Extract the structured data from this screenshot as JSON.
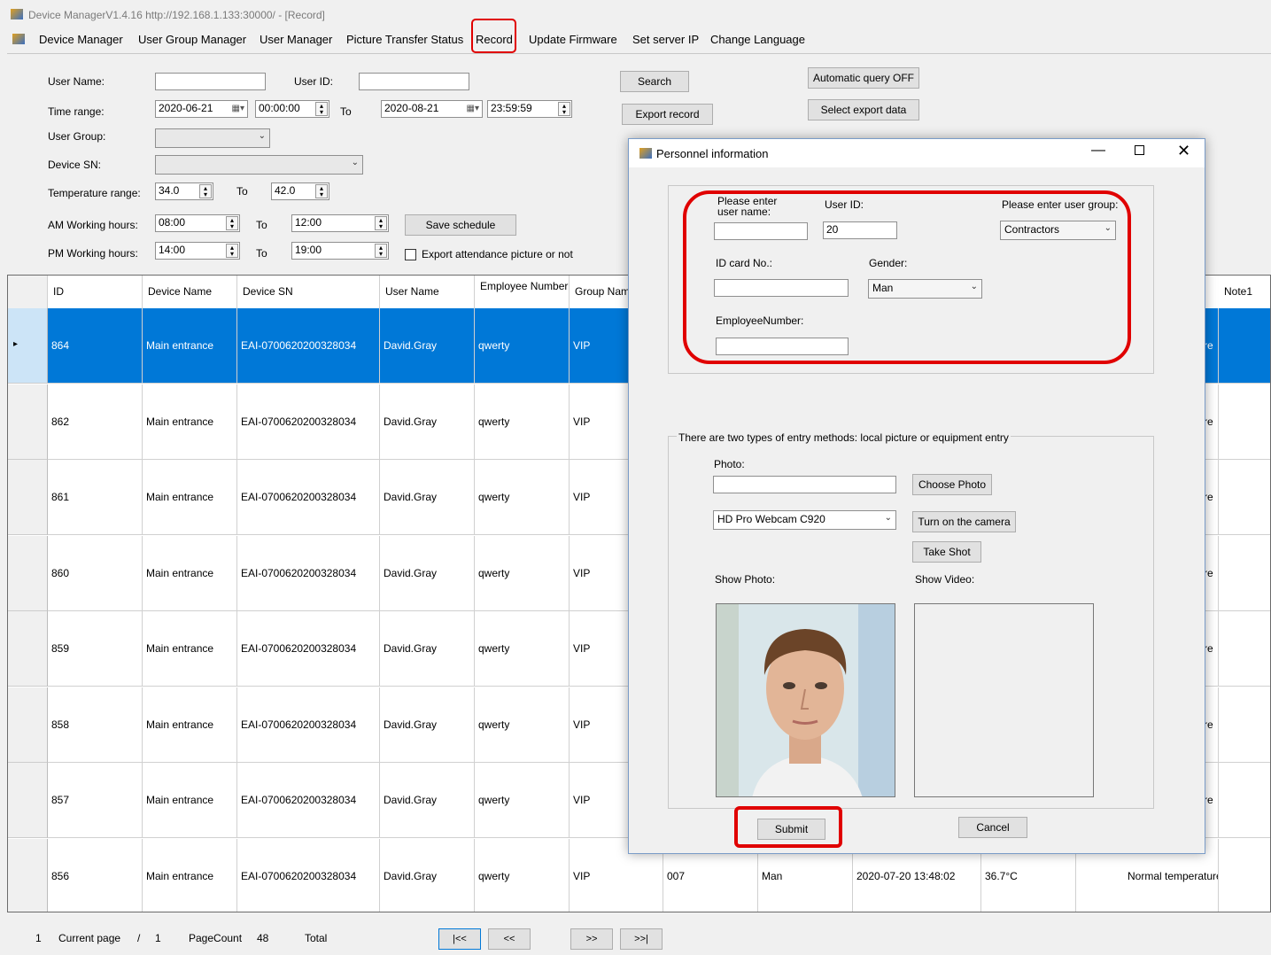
{
  "window": {
    "title": "Device ManagerV1.4.16 http://192.168.1.133:30000/ - [Record]"
  },
  "menu": [
    "Device Manager",
    "User Group Manager",
    "User Manager",
    "Picture Transfer Status",
    "Record",
    "Update Firmware",
    "Set server IP",
    "Change Language"
  ],
  "form": {
    "user_name_label": "User Name:",
    "user_name_value": "",
    "user_id_label": "User ID:",
    "user_id_value": "",
    "time_range_label": "Time range:",
    "start_date": "2020-06-21",
    "start_time": "00:00:00",
    "to_label": "To",
    "end_date": "2020-08-21",
    "end_time": "23:59:59",
    "user_group_label": "User Group:",
    "user_group_value": "",
    "device_sn_label": "Device SN:",
    "device_sn_value": "",
    "temp_range_label": "Temperature range:",
    "temp_from": "34.0",
    "temp_to": "42.0",
    "am_label": "AM Working hours:",
    "am_from": "08:00",
    "am_to": "12:00",
    "pm_label": "PM Working hours:",
    "pm_from": "14:00",
    "pm_to": "19:00",
    "search_button": "Search",
    "export_button": "Export record",
    "auto_query_button": "Automatic query  OFF",
    "select_export_button": "Select export data",
    "save_schedule_button": "Save schedule",
    "export_picture_label": "Export attendance picture or not"
  },
  "grid": {
    "headers": [
      "ID",
      "Device Name",
      "Device SN",
      "User Name",
      "Employee Number",
      "Group Nam",
      "Note1"
    ],
    "rows": [
      {
        "id": "864",
        "device": "Main entrance",
        "sn": "EAI-0700620200328034",
        "user": "David.Gray",
        "emp": "qwerty",
        "group": "VIP",
        "tail": "re",
        "selected": true
      },
      {
        "id": "862",
        "device": "Main entrance",
        "sn": "EAI-0700620200328034",
        "user": "David.Gray",
        "emp": "qwerty",
        "group": "VIP",
        "tail": "re"
      },
      {
        "id": "861",
        "device": "Main entrance",
        "sn": "EAI-0700620200328034",
        "user": "David.Gray",
        "emp": "qwerty",
        "group": "VIP",
        "tail": "re"
      },
      {
        "id": "860",
        "device": "Main entrance",
        "sn": "EAI-0700620200328034",
        "user": "David.Gray",
        "emp": "qwerty",
        "group": "VIP",
        "tail": "re"
      },
      {
        "id": "859",
        "device": "Main entrance",
        "sn": "EAI-0700620200328034",
        "user": "David.Gray",
        "emp": "qwerty",
        "group": "VIP",
        "tail": "re"
      },
      {
        "id": "858",
        "device": "Main entrance",
        "sn": "EAI-0700620200328034",
        "user": "David.Gray",
        "emp": "qwerty",
        "group": "VIP",
        "tail": "re"
      },
      {
        "id": "857",
        "device": "Main entrance",
        "sn": "EAI-0700620200328034",
        "user": "David.Gray",
        "emp": "qwerty",
        "group": "VIP",
        "tail": "re"
      },
      {
        "id": "856",
        "device": "Main entrance",
        "sn": "EAI-0700620200328034",
        "user": "David.Gray",
        "emp": "qwerty",
        "group": "VIP",
        "extra_num": "007",
        "gender": "Man",
        "time": "2020-07-20  13:48:02",
        "temp": "36.7°C",
        "status": "Normal temperature"
      }
    ]
  },
  "footer": {
    "current_page_num": "1",
    "current_page_label": "Current page",
    "slash": "/",
    "page_count_num": "1",
    "page_count_label": "PageCount",
    "total_num": "48",
    "total_label": "Total",
    "first_btn": "|<<",
    "prev_btn": "<<",
    "next_btn": ">>",
    "last_btn": ">>|"
  },
  "dialog": {
    "title": "Personnel information",
    "user_name_label": "Please enter user name:",
    "user_name_value": "",
    "user_id_label": "User ID:",
    "user_id_value": "20",
    "user_group_label": "Please enter user group:",
    "user_group_value": "Contractors",
    "id_card_label": "ID card No.:",
    "id_card_value": "",
    "gender_label": "Gender:",
    "gender_value": "Man",
    "employee_number_label": "EmployeeNumber:",
    "employee_number_value": "",
    "entry_methods_text": "There are two types of entry methods: local picture or equipment entry",
    "photo_label": "Photo:",
    "photo_path": "",
    "choose_photo_button": "Choose Photo",
    "camera_value": "HD Pro Webcam C920",
    "turn_on_camera_button": "Turn on the camera",
    "take_shot_button": "Take Shot",
    "show_photo_label": "Show Photo:",
    "show_video_label": "Show Video:",
    "submit_button": "Submit",
    "cancel_button": "Cancel"
  },
  "colors": {
    "selection": "#0078d7",
    "highlight_red": "#e00000"
  }
}
